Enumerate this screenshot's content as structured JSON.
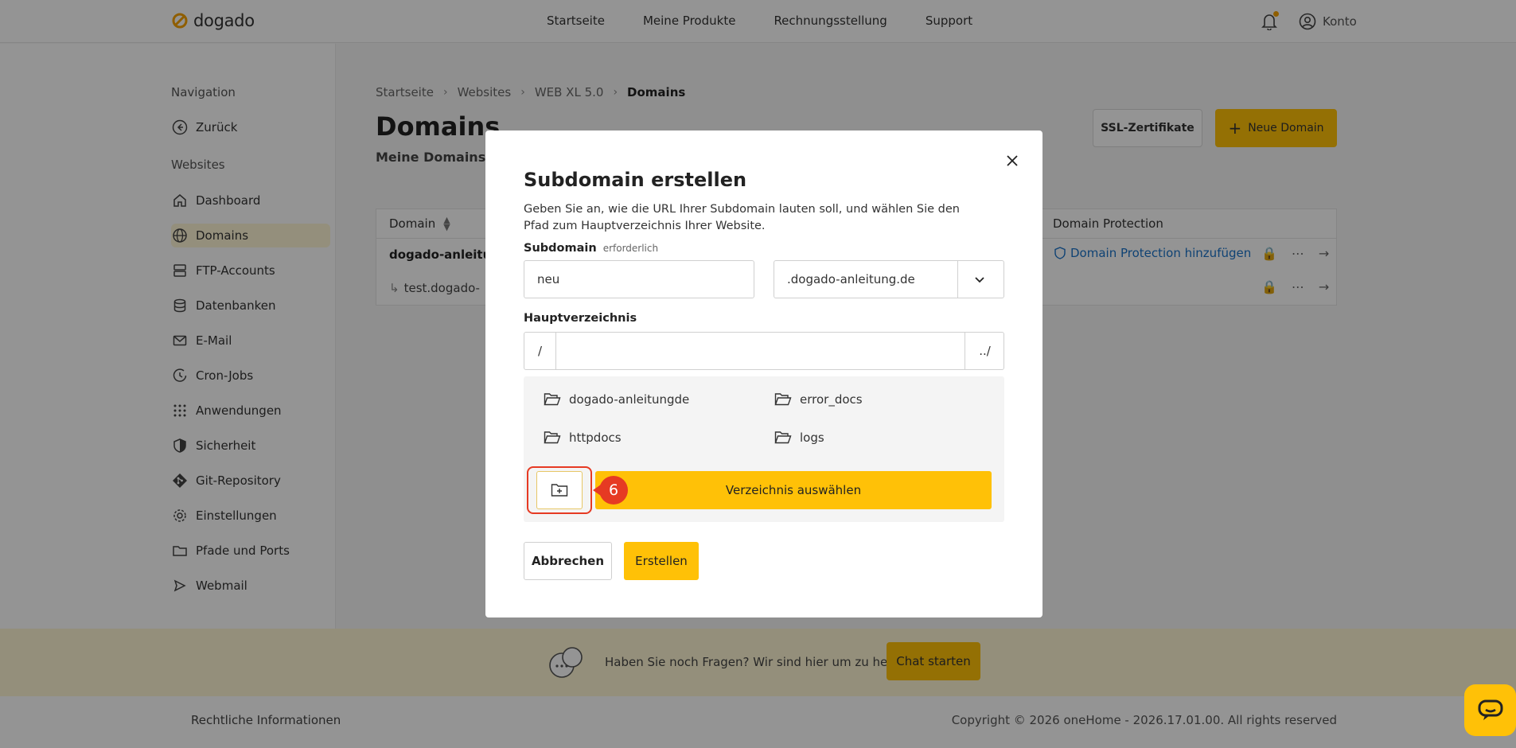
{
  "header": {
    "logo_text": "dogado",
    "nav": [
      "Startseite",
      "Meine Produkte",
      "Rechnungsstellung",
      "Support"
    ],
    "account_label": "Konto"
  },
  "sidebar": {
    "section_navigation": "Navigation",
    "back_label": "Zurück",
    "section_websites": "Websites",
    "items": [
      {
        "label": "Dashboard",
        "icon": "home-icon"
      },
      {
        "label": "Domains",
        "icon": "globe-icon"
      },
      {
        "label": "FTP-Accounts",
        "icon": "server-icon"
      },
      {
        "label": "Datenbanken",
        "icon": "database-icon"
      },
      {
        "label": "E-Mail",
        "icon": "mail-icon"
      },
      {
        "label": "Cron-Jobs",
        "icon": "clock-icon"
      },
      {
        "label": "Anwendungen",
        "icon": "grid-icon"
      },
      {
        "label": "Sicherheit",
        "icon": "shield-icon"
      },
      {
        "label": "Git-Repository",
        "icon": "git-icon"
      },
      {
        "label": "Einstellungen",
        "icon": "gear-icon"
      },
      {
        "label": "Pfade und Ports",
        "icon": "folder-icon"
      },
      {
        "label": "Webmail",
        "icon": "send-icon"
      }
    ]
  },
  "main": {
    "breadcrumb": [
      "Startseite",
      "Websites",
      "WEB XL 5.0",
      "Domains"
    ],
    "title": "Domains",
    "subtab": "Meine Domains",
    "ssl_button": "SSL-Zertifikate",
    "new_domain_button": "Neue Domain",
    "table": {
      "col_domain": "Domain",
      "col_protection": "Domain Protection",
      "row1_domain": "dogado-anleitung",
      "row2_domain": "test.dogado-",
      "protection_link": "Domain Protection hinzufügen"
    }
  },
  "footer": {
    "help_text": "Haben Sie noch Fragen? Wir sind hier um zu helfen.",
    "chat_button": "Chat starten",
    "legal": "Rechtliche Informationen",
    "copyright": "Copyright © 2026 oneHome - 2026.17.01.00. All rights reserved"
  },
  "modal": {
    "title": "Subdomain erstellen",
    "description": "Geben Sie an, wie die URL Ihrer Subdomain lauten soll, und wählen Sie den Pfad zum Hauptverzeichnis Ihrer Website.",
    "subdomain_label": "Subdomain",
    "required_note": "erforderlich",
    "subdomain_value": "neu",
    "domain_select_value": ".dogado-anleitung.de",
    "root_dir_label": "Hauptverzeichnis",
    "path_prefix": "/",
    "path_value": "",
    "path_up": "../",
    "directories": [
      "dogado-anleitungde",
      "error_docs",
      "httpdocs",
      "logs"
    ],
    "step_number": "6",
    "select_dir_button": "Verzeichnis auswählen",
    "cancel_button": "Abbrechen",
    "create_button": "Erstellen"
  },
  "colors": {
    "accent": "#ffc107",
    "highlight": "#e63a23",
    "link": "#1a73c8"
  }
}
